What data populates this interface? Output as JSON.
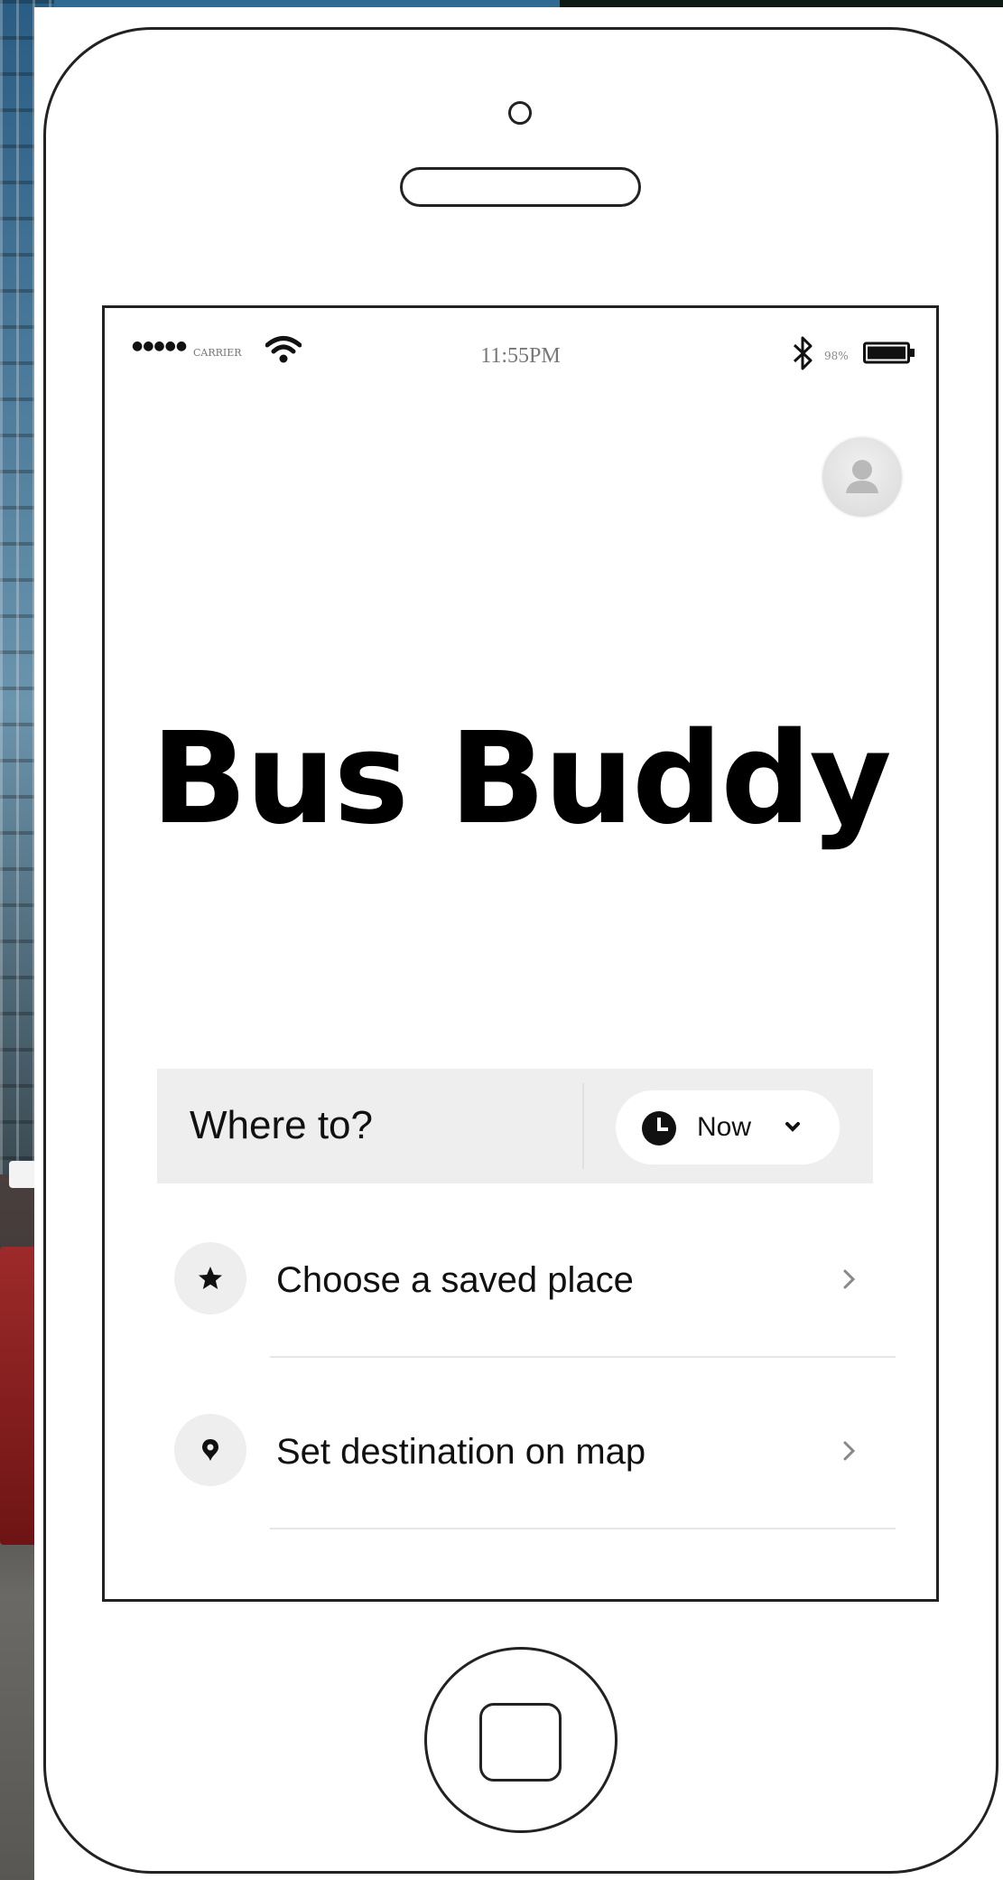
{
  "status_bar": {
    "signal": "●●●●●",
    "carrier": "CARRIER",
    "time": "11:55PM",
    "battery_percent": "98%"
  },
  "app": {
    "title": "Bus Buddy"
  },
  "search": {
    "where_to_label": "Where to?",
    "time_option_label": "Now"
  },
  "list": {
    "items": [
      {
        "label": "Choose a saved place",
        "icon": "star-icon"
      },
      {
        "label": "Set destination on map",
        "icon": "map-pin-icon"
      }
    ]
  }
}
